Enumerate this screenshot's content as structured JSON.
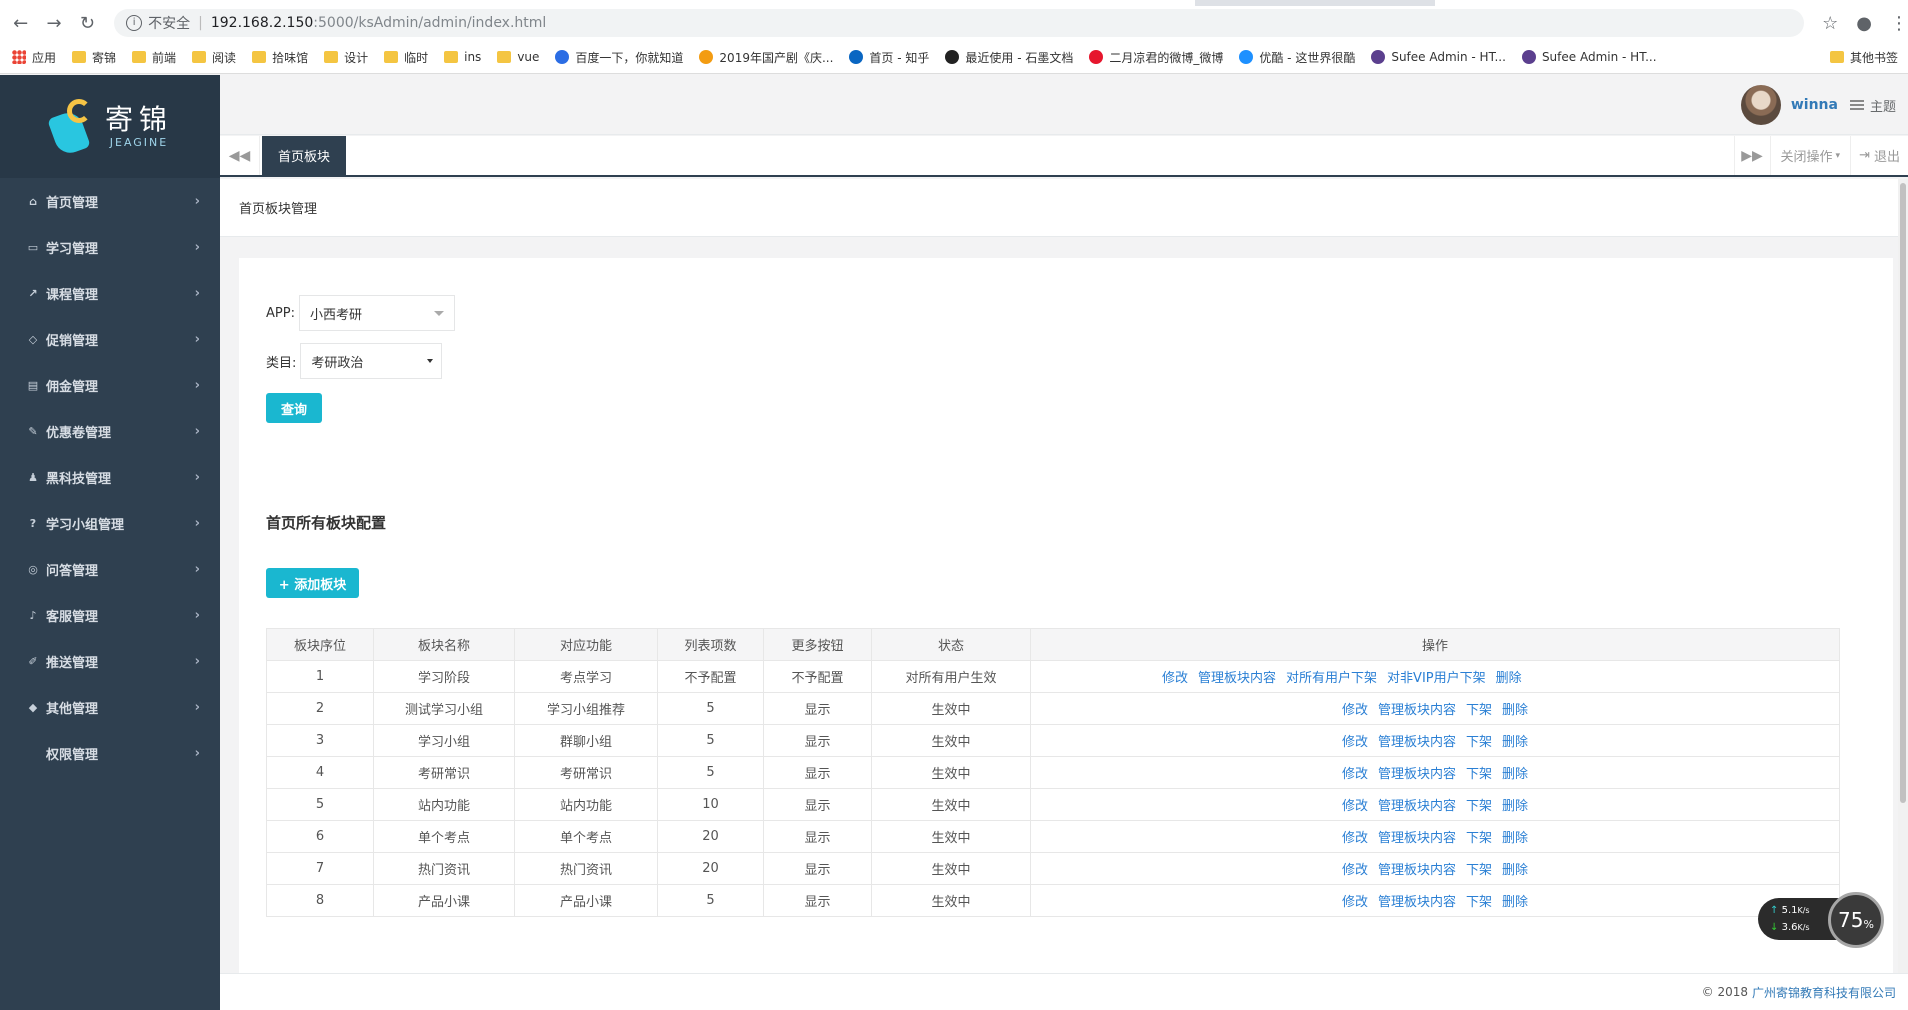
{
  "browser": {
    "insecure_label": "不安全",
    "url_host": "192.168.2.150",
    "url_path": ":5000/ksAdmin/admin/index.html",
    "bookmarks": [
      {
        "label": "应用",
        "kind": "apps"
      },
      {
        "label": "寄锦",
        "kind": "folder"
      },
      {
        "label": "前端",
        "kind": "folder"
      },
      {
        "label": "阅读",
        "kind": "folder"
      },
      {
        "label": "拾味馆",
        "kind": "folder"
      },
      {
        "label": "设计",
        "kind": "folder"
      },
      {
        "label": "临时",
        "kind": "folder"
      },
      {
        "label": "ins",
        "kind": "folder"
      },
      {
        "label": "vue",
        "kind": "folder"
      },
      {
        "label": "百度一下，你就知道",
        "kind": "baidu"
      },
      {
        "label": "2019年国产剧《庆...",
        "kind": "video"
      },
      {
        "label": "首页 - 知乎",
        "kind": "zhihu"
      },
      {
        "label": "最近使用 - 石墨文档",
        "kind": "shimo"
      },
      {
        "label": "二月凉君的微博_微博",
        "kind": "weibo"
      },
      {
        "label": "优酷 - 这世界很酷",
        "kind": "youku"
      },
      {
        "label": "Sufee Admin - HT...",
        "kind": "sufee"
      },
      {
        "label": "Sufee Admin - HT...",
        "kind": "sufee"
      }
    ],
    "other_bookmarks": "其他书签"
  },
  "logo": {
    "cn": "寄锦",
    "en": "JEAGINE"
  },
  "sidebar": {
    "items": [
      {
        "label": "首页管理",
        "icon": "home-icon",
        "glyph": "⌂"
      },
      {
        "label": "学习管理",
        "icon": "book-icon",
        "glyph": "▭"
      },
      {
        "label": "课程管理",
        "icon": "chart-icon",
        "glyph": "↗"
      },
      {
        "label": "促销管理",
        "icon": "diamond-icon",
        "glyph": "◇"
      },
      {
        "label": "佣金管理",
        "icon": "card-icon",
        "glyph": "▤"
      },
      {
        "label": "优惠卷管理",
        "icon": "gavel-icon",
        "glyph": "✎"
      },
      {
        "label": "黑科技管理",
        "icon": "users-icon",
        "glyph": "♟"
      },
      {
        "label": "学习小组管理",
        "icon": "question-icon",
        "glyph": "?"
      },
      {
        "label": "问答管理",
        "icon": "chat-icon",
        "glyph": "◎"
      },
      {
        "label": "客服管理",
        "icon": "bell-icon",
        "glyph": "♪"
      },
      {
        "label": "推送管理",
        "icon": "wrench-icon",
        "glyph": "✐"
      },
      {
        "label": "其他管理",
        "icon": "shield-icon",
        "glyph": "◆"
      },
      {
        "label": "权限管理",
        "icon": "",
        "glyph": ""
      }
    ]
  },
  "header": {
    "username": "winna",
    "theme": "主题"
  },
  "tabs": {
    "active": "首页板块",
    "close_ops": "关闭操作",
    "logout": "退出"
  },
  "breadcrumb": "首页板块管理",
  "form": {
    "app_label": "APP:",
    "app_value": "小西考研",
    "category_label": "类目:",
    "category_value": "考研政治",
    "query_button": "查询"
  },
  "section_title": "首页所有板块配置",
  "add_button": "+ 添加板块",
  "table": {
    "headers": [
      "板块序位",
      "板块名称",
      "对应功能",
      "列表项数",
      "更多按钮",
      "状态",
      "操作"
    ],
    "rows": [
      {
        "order": "1",
        "name": "学习阶段",
        "func": "考点学习",
        "count": "不予配置",
        "more": "不予配置",
        "status": "对所有用户生效",
        "ops": [
          "修改",
          "管理板块内容",
          "对所有用户下架",
          "对非VIP用户下架",
          "删除"
        ]
      },
      {
        "order": "2",
        "name": "测试学习小组",
        "func": "学习小组推荐",
        "count": "5",
        "more": "显示",
        "status": "生效中",
        "ops": [
          "修改",
          "管理板块内容",
          "下架",
          "删除"
        ]
      },
      {
        "order": "3",
        "name": "学习小组",
        "func": "群聊小组",
        "count": "5",
        "more": "显示",
        "status": "生效中",
        "ops": [
          "修改",
          "管理板块内容",
          "下架",
          "删除"
        ]
      },
      {
        "order": "4",
        "name": "考研常识",
        "func": "考研常识",
        "count": "5",
        "more": "显示",
        "status": "生效中",
        "ops": [
          "修改",
          "管理板块内容",
          "下架",
          "删除"
        ]
      },
      {
        "order": "5",
        "name": "站内功能",
        "func": "站内功能",
        "count": "10",
        "more": "显示",
        "status": "生效中",
        "ops": [
          "修改",
          "管理板块内容",
          "下架",
          "删除"
        ]
      },
      {
        "order": "6",
        "name": "单个考点",
        "func": "单个考点",
        "count": "20",
        "more": "显示",
        "status": "生效中",
        "ops": [
          "修改",
          "管理板块内容",
          "下架",
          "删除"
        ]
      },
      {
        "order": "7",
        "name": "热门资讯",
        "func": "热门资讯",
        "count": "20",
        "more": "显示",
        "status": "生效中",
        "ops": [
          "修改",
          "管理板块内容",
          "下架",
          "删除"
        ]
      },
      {
        "order": "8",
        "name": "产品小课",
        "func": "产品小课",
        "count": "5",
        "more": "显示",
        "status": "生效中",
        "ops": [
          "修改",
          "管理板块内容",
          "下架",
          "删除"
        ]
      }
    ]
  },
  "footer": {
    "copyright": "© 2018",
    "company": "广州寄锦教育科技有限公司"
  },
  "net_widget": {
    "up": "5.1",
    "down": "3.6",
    "unit": "K/s",
    "percent": "75"
  }
}
